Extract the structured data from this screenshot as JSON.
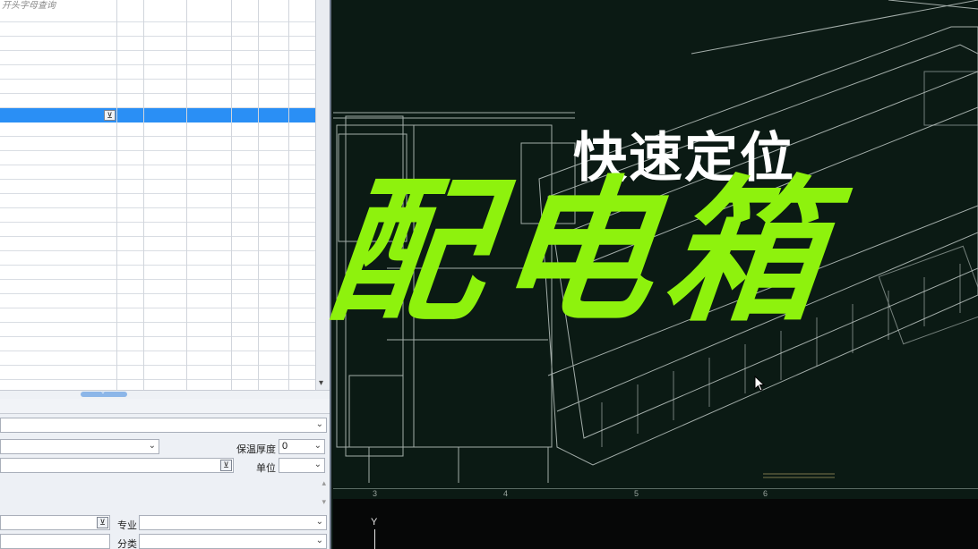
{
  "left_panel": {
    "grid_hint": "开头字母查询",
    "dropdown_glyph": "⊻",
    "scroll_down_glyph": "▾",
    "hscroll_glyph": "⌄"
  },
  "form": {
    "insulation_label": "保温厚度",
    "insulation_value": "0",
    "unit_label": "单位",
    "unit_value": "",
    "major_label": "专业",
    "major_value": "",
    "category_label": "分类",
    "category_value": "",
    "caret_glyph": "⌄",
    "download_glyph": "⊻"
  },
  "overlay": {
    "subtitle": "快速定位",
    "title": "配电箱"
  },
  "cad": {
    "ruler_labels": [
      "3",
      "4",
      "5",
      "6"
    ],
    "axis_y_label": "Y",
    "colors": {
      "background": "#0b1a14",
      "lines": "#c9d2cf",
      "title_green": "#8ef20d"
    }
  }
}
